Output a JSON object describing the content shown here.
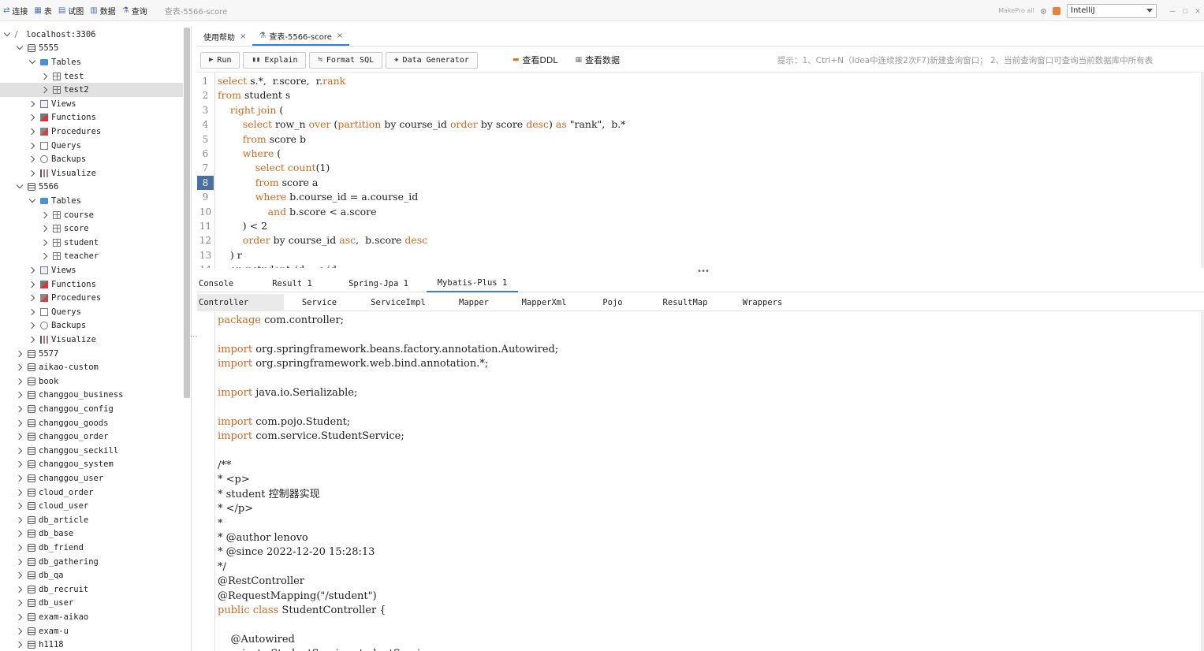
{
  "toolbar": {
    "items": [
      {
        "label": "连接",
        "icon": "connect-icon"
      },
      {
        "label": "表",
        "icon": "table-icon"
      },
      {
        "label": "试图",
        "icon": "view-icon"
      },
      {
        "label": "数据",
        "icon": "data-icon"
      },
      {
        "label": "查询",
        "icon": "query-icon"
      }
    ],
    "window_title": "查表-5566-score",
    "right_label": "MakePro all",
    "ide_select": "IntelliJ"
  },
  "sidebar": {
    "rows": [
      {
        "indent": 0,
        "chev": "down",
        "icon": "server",
        "label": "localhost:3306"
      },
      {
        "indent": 1,
        "chev": "down",
        "icon": "db",
        "label": "5555"
      },
      {
        "indent": 2,
        "chev": "down",
        "icon": "folder",
        "label": "Tables"
      },
      {
        "indent": 3,
        "chev": "right",
        "icon": "table",
        "label": "test"
      },
      {
        "indent": 3,
        "chev": "right",
        "icon": "table",
        "label": "test2",
        "selected": true
      },
      {
        "indent": 2,
        "chev": "right",
        "icon": "view",
        "label": "Views"
      },
      {
        "indent": 2,
        "chev": "right",
        "icon": "func",
        "label": "Functions"
      },
      {
        "indent": 2,
        "chev": "right",
        "icon": "proc",
        "label": "Procedures"
      },
      {
        "indent": 2,
        "chev": "right",
        "icon": "query",
        "label": "Querys"
      },
      {
        "indent": 2,
        "chev": "right",
        "icon": "backup",
        "label": "Backups"
      },
      {
        "indent": 2,
        "chev": "right",
        "icon": "vis",
        "label": "Visualize"
      },
      {
        "indent": 1,
        "chev": "down",
        "icon": "db",
        "label": "5566"
      },
      {
        "indent": 2,
        "chev": "down",
        "icon": "folder",
        "label": "Tables"
      },
      {
        "indent": 3,
        "chev": "right",
        "icon": "table",
        "label": "course"
      },
      {
        "indent": 3,
        "chev": "right",
        "icon": "table",
        "label": "score"
      },
      {
        "indent": 3,
        "chev": "right",
        "icon": "table",
        "label": "student"
      },
      {
        "indent": 3,
        "chev": "right",
        "icon": "table",
        "label": "teacher"
      },
      {
        "indent": 2,
        "chev": "right",
        "icon": "view",
        "label": "Views"
      },
      {
        "indent": 2,
        "chev": "right",
        "icon": "func",
        "label": "Functions"
      },
      {
        "indent": 2,
        "chev": "right",
        "icon": "proc",
        "label": "Procedures"
      },
      {
        "indent": 2,
        "chev": "right",
        "icon": "query",
        "label": "Querys"
      },
      {
        "indent": 2,
        "chev": "right",
        "icon": "backup",
        "label": "Backups"
      },
      {
        "indent": 2,
        "chev": "right",
        "icon": "vis",
        "label": "Visualize"
      },
      {
        "indent": 1,
        "chev": "right",
        "icon": "db",
        "label": "5577"
      },
      {
        "indent": 1,
        "chev": "right",
        "icon": "db",
        "label": "aikao-custom"
      },
      {
        "indent": 1,
        "chev": "right",
        "icon": "db",
        "label": "book"
      },
      {
        "indent": 1,
        "chev": "right",
        "icon": "db",
        "label": "changgou_business"
      },
      {
        "indent": 1,
        "chev": "right",
        "icon": "db",
        "label": "changgou_config"
      },
      {
        "indent": 1,
        "chev": "right",
        "icon": "db",
        "label": "changgou_goods"
      },
      {
        "indent": 1,
        "chev": "right",
        "icon": "db",
        "label": "changgou_order"
      },
      {
        "indent": 1,
        "chev": "right",
        "icon": "db",
        "label": "changgou_seckill"
      },
      {
        "indent": 1,
        "chev": "right",
        "icon": "db",
        "label": "changgou_system"
      },
      {
        "indent": 1,
        "chev": "right",
        "icon": "db",
        "label": "changgou_user"
      },
      {
        "indent": 1,
        "chev": "right",
        "icon": "db",
        "label": "cloud_order"
      },
      {
        "indent": 1,
        "chev": "right",
        "icon": "db",
        "label": "cloud_user"
      },
      {
        "indent": 1,
        "chev": "right",
        "icon": "db",
        "label": "db_article"
      },
      {
        "indent": 1,
        "chev": "right",
        "icon": "db",
        "label": "db_base"
      },
      {
        "indent": 1,
        "chev": "right",
        "icon": "db",
        "label": "db_friend"
      },
      {
        "indent": 1,
        "chev": "right",
        "icon": "db",
        "label": "db_gathering"
      },
      {
        "indent": 1,
        "chev": "right",
        "icon": "db",
        "label": "db_qa"
      },
      {
        "indent": 1,
        "chev": "right",
        "icon": "db",
        "label": "db_recruit"
      },
      {
        "indent": 1,
        "chev": "right",
        "icon": "db",
        "label": "db_user"
      },
      {
        "indent": 1,
        "chev": "right",
        "icon": "db",
        "label": "exam-aikao"
      },
      {
        "indent": 1,
        "chev": "right",
        "icon": "db",
        "label": "exam-u"
      },
      {
        "indent": 1,
        "chev": "right",
        "icon": "db",
        "label": "h1118"
      }
    ]
  },
  "tabs": [
    {
      "label": "使用帮助",
      "active": false
    },
    {
      "label": "查表-5566-score",
      "active": true
    }
  ],
  "actions": {
    "run": "Run",
    "explain": "Explain",
    "format": "Format SQL",
    "generator": "Data Generator",
    "ddl": "查看DDL",
    "view_data": "查看数据",
    "hint": "提示：1、Ctrl+N（Idea中连续按2次F7)新建查询窗口； 2、当前查询窗口可查询当前数据库中所有表"
  },
  "sql": {
    "current_line": 8,
    "lines": [
      [
        {
          "t": "select",
          "k": 1
        },
        {
          "t": " s.*,  r.score,  r."
        },
        {
          "t": "rank",
          "k": 1
        }
      ],
      [
        {
          "t": "from",
          "k": 1
        },
        {
          "t": " student s"
        }
      ],
      [
        {
          "t": "    "
        },
        {
          "t": "right join",
          "k": 1
        },
        {
          "t": " ("
        }
      ],
      [
        {
          "t": "        "
        },
        {
          "t": "select",
          "k": 1
        },
        {
          "t": " row_n "
        },
        {
          "t": "over",
          "k": 1
        },
        {
          "t": " ("
        },
        {
          "t": "partition",
          "k": 1
        },
        {
          "t": " by course_id "
        },
        {
          "t": "order",
          "k": 1
        },
        {
          "t": " by score "
        },
        {
          "t": "desc",
          "k": 1
        },
        {
          "t": ") "
        },
        {
          "t": "as",
          "k": 1
        },
        {
          "t": " \"rank\",  b.*"
        }
      ],
      [
        {
          "t": "        "
        },
        {
          "t": "from",
          "k": 1
        },
        {
          "t": " score b"
        }
      ],
      [
        {
          "t": "        "
        },
        {
          "t": "where",
          "k": 1
        },
        {
          "t": " ("
        }
      ],
      [
        {
          "t": "            "
        },
        {
          "t": "select",
          "k": 1
        },
        {
          "t": " "
        },
        {
          "t": "count",
          "k": 1
        },
        {
          "t": "(1)"
        }
      ],
      [
        {
          "t": "            "
        },
        {
          "t": "from",
          "k": 1
        },
        {
          "t": " score a"
        }
      ],
      [
        {
          "t": "            "
        },
        {
          "t": "where",
          "k": 1
        },
        {
          "t": " b.course_id = a.course_id"
        }
      ],
      [
        {
          "t": "                "
        },
        {
          "t": "and",
          "k": 1
        },
        {
          "t": " b.score < a.score"
        }
      ],
      [
        {
          "t": "        ) < 2"
        }
      ],
      [
        {
          "t": "        "
        },
        {
          "t": "order",
          "k": 1
        },
        {
          "t": " by course_id "
        },
        {
          "t": "asc",
          "k": 1
        },
        {
          "t": ",  b.score "
        },
        {
          "t": "desc",
          "k": 1
        }
      ],
      [
        {
          "t": "    ) r"
        }
      ],
      [
        {
          "t": "    on r.student_id = s.id"
        }
      ]
    ]
  },
  "result_tabs": [
    {
      "label": "Console",
      "active": false
    },
    {
      "label": "Result 1",
      "active": false
    },
    {
      "label": "Spring-Jpa 1",
      "active": false
    },
    {
      "label": "Mybatis-Plus 1",
      "active": true
    }
  ],
  "sub_tabs": [
    {
      "label": "Controller",
      "active": true
    },
    {
      "label": "Service",
      "active": false
    },
    {
      "label": "ServiceImpl",
      "active": false
    },
    {
      "label": "Mapper",
      "active": false
    },
    {
      "label": "MapperXml",
      "active": false
    },
    {
      "label": "Pojo",
      "active": false
    },
    {
      "label": "ResultMap",
      "active": false
    },
    {
      "label": "Wrappers",
      "active": false
    }
  ],
  "generated_code": [
    [
      {
        "t": "package",
        "k": 1
      },
      {
        "t": " com.controller;"
      }
    ],
    [],
    [
      {
        "t": "import",
        "k": 1
      },
      {
        "t": " org.springframework.beans.factory.annotation.Autowired;"
      }
    ],
    [
      {
        "t": "import",
        "k": 1
      },
      {
        "t": " org.springframework.web.bind.annotation.*;"
      }
    ],
    [],
    [
      {
        "t": "import",
        "k": 1
      },
      {
        "t": " java.io.Serializable;"
      }
    ],
    [],
    [
      {
        "t": "import",
        "k": 1
      },
      {
        "t": " com.pojo.Student;"
      }
    ],
    [
      {
        "t": "import",
        "k": 1
      },
      {
        "t": " com.service.StudentService;"
      }
    ],
    [],
    [
      {
        "t": "/**"
      }
    ],
    [
      {
        "t": "* <p>"
      }
    ],
    [
      {
        "t": "* student 控制器实现"
      }
    ],
    [
      {
        "t": "* </p>"
      }
    ],
    [
      {
        "t": "*"
      }
    ],
    [
      {
        "t": "* @author lenovo"
      }
    ],
    [
      {
        "t": "* @since 2022-12-20 15:28:13"
      }
    ],
    [
      {
        "t": "*/"
      }
    ],
    [
      {
        "t": "@RestController"
      }
    ],
    [
      {
        "t": "@RequestMapping(\"/student\")"
      }
    ],
    [
      {
        "t": "public class",
        "k": 1
      },
      {
        "t": " StudentController {"
      }
    ],
    [],
    [
      {
        "t": "    @Autowired"
      }
    ],
    [
      {
        "t": "    private StudentService studentService;"
      }
    ]
  ],
  "colors": {
    "keyword": "#d2691e",
    "accent": "#3a7bd5",
    "current_line": "#4a6fa5"
  }
}
